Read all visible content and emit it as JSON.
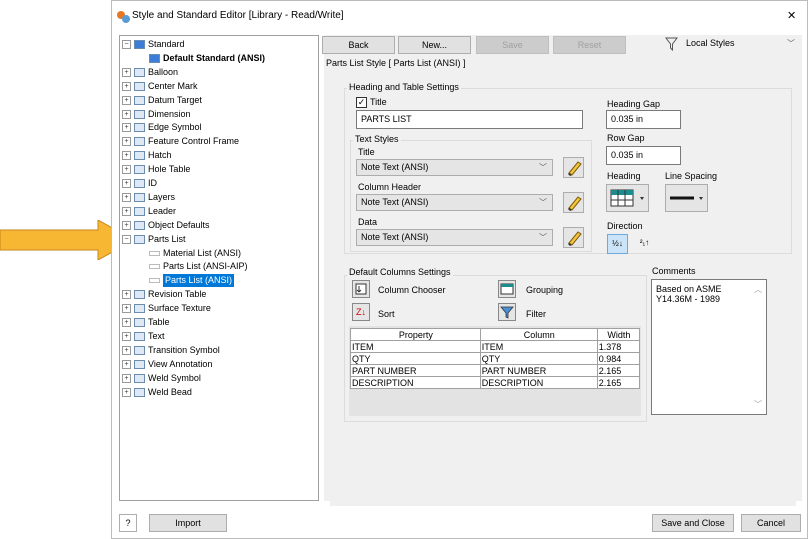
{
  "window": {
    "title": "Style and Standard Editor [Library - Read/Write]",
    "close": "✕"
  },
  "tree": [
    {
      "label": "Standard",
      "depth": 0,
      "exp": "−",
      "icon": "standard-icon"
    },
    {
      "label": "Default Standard (ANSI)",
      "depth": 1,
      "bold": true,
      "icon": "standard-icon"
    },
    {
      "label": "Balloon",
      "depth": 0,
      "exp": "+",
      "icon": "balloon-icon"
    },
    {
      "label": "Center Mark",
      "depth": 0,
      "exp": "+",
      "icon": "center-mark-icon"
    },
    {
      "label": "Datum Target",
      "depth": 0,
      "exp": "+",
      "icon": "datum-target-icon"
    },
    {
      "label": "Dimension",
      "depth": 0,
      "exp": "+",
      "icon": "dimension-icon"
    },
    {
      "label": "Edge Symbol",
      "depth": 0,
      "exp": "+",
      "icon": "edge-symbol-icon"
    },
    {
      "label": "Feature Control Frame",
      "depth": 0,
      "exp": "+",
      "icon": "fcf-icon"
    },
    {
      "label": "Hatch",
      "depth": 0,
      "exp": "+",
      "icon": "hatch-icon"
    },
    {
      "label": "Hole Table",
      "depth": 0,
      "exp": "+",
      "icon": "hole-table-icon"
    },
    {
      "label": "ID",
      "depth": 0,
      "exp": "+",
      "icon": "id-icon"
    },
    {
      "label": "Layers",
      "depth": 0,
      "exp": "+",
      "icon": "layers-icon"
    },
    {
      "label": "Leader",
      "depth": 0,
      "exp": "+",
      "icon": "leader-icon"
    },
    {
      "label": "Object Defaults",
      "depth": 0,
      "exp": "+",
      "icon": "object-defaults-icon"
    },
    {
      "label": "Parts List",
      "depth": 0,
      "exp": "−",
      "icon": "parts-list-icon"
    },
    {
      "label": "Material List (ANSI)",
      "depth": 1,
      "icon": "style-icon"
    },
    {
      "label": "Parts List (ANSI-AIP)",
      "depth": 1,
      "icon": "style-icon"
    },
    {
      "label": "Parts List (ANSI)",
      "depth": 1,
      "selected": true,
      "icon": "style-icon"
    },
    {
      "label": "Revision Table",
      "depth": 0,
      "exp": "+",
      "icon": "revision-table-icon"
    },
    {
      "label": "Surface Texture",
      "depth": 0,
      "exp": "+",
      "icon": "surface-texture-icon"
    },
    {
      "label": "Table",
      "depth": 0,
      "exp": "+",
      "icon": "table-icon"
    },
    {
      "label": "Text",
      "depth": 0,
      "exp": "+",
      "icon": "text-icon"
    },
    {
      "label": "Transition Symbol",
      "depth": 0,
      "exp": "+",
      "icon": "transition-icon"
    },
    {
      "label": "View Annotation",
      "depth": 0,
      "exp": "+",
      "icon": "view-annotation-icon"
    },
    {
      "label": "Weld Symbol",
      "depth": 0,
      "exp": "+",
      "icon": "weld-symbol-icon"
    },
    {
      "label": "Weld Bead",
      "depth": 0,
      "exp": "+",
      "icon": "weld-bead-icon"
    }
  ],
  "toolbar": {
    "back": "Back",
    "new": "New...",
    "save": "Save",
    "reset": "Reset",
    "filter_value": "Local Styles"
  },
  "style_header": "Parts List Style [ Parts List (ANSI) ]",
  "heading": {
    "group_label": "Heading and Table Settings",
    "title_check": "Title",
    "title_value": "PARTS LIST",
    "heading_gap_label": "Heading Gap",
    "heading_gap_value": "0.035 in",
    "row_gap_label": "Row Gap",
    "row_gap_value": "0.035 in",
    "text_styles_label": "Text Styles",
    "title_label": "Title",
    "title_style": "Note Text (ANSI)",
    "column_header_label": "Column Header",
    "column_header_style": "Note Text (ANSI)",
    "data_label": "Data",
    "data_style": "Note Text (ANSI)",
    "heading_label": "Heading",
    "line_spacing_label": "Line Spacing",
    "direction_label": "Direction"
  },
  "columns": {
    "group_label": "Default Columns Settings",
    "column_chooser": "Column Chooser",
    "grouping": "Grouping",
    "sort": "Sort",
    "filter": "Filter",
    "headers": [
      "Property",
      "Column",
      "Width"
    ],
    "rows": [
      [
        "ITEM",
        "ITEM",
        "1.378"
      ],
      [
        "QTY",
        "QTY",
        "0.984"
      ],
      [
        "PART NUMBER",
        "PART NUMBER",
        "2.165"
      ],
      [
        "DESCRIPTION",
        "DESCRIPTION",
        "2.165"
      ]
    ]
  },
  "comments": {
    "label": "Comments",
    "text": "Based on ASME Y14.36M - 1989"
  },
  "footer": {
    "help": "?",
    "import": "Import",
    "save_close": "Save and Close",
    "cancel": "Cancel"
  },
  "colors": {
    "accent": "#0078d7",
    "arrow": "#f7b733",
    "panel": "#f0f0f0"
  }
}
